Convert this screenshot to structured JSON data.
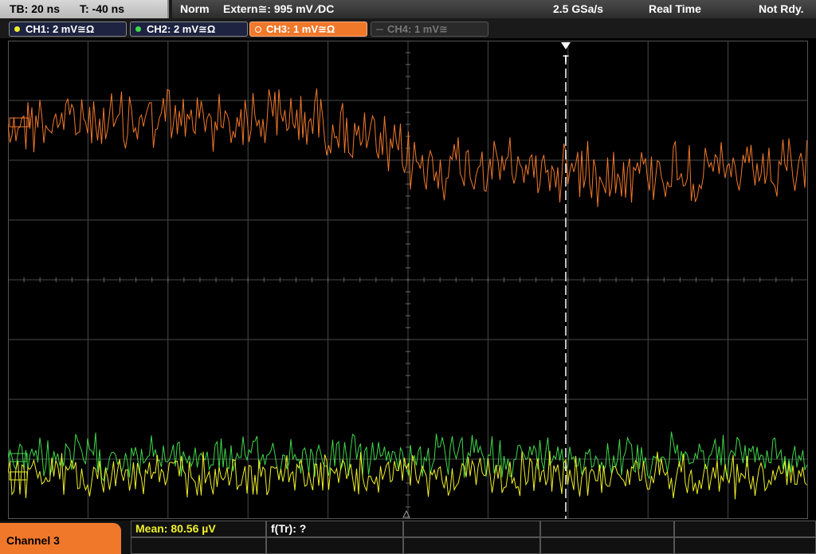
{
  "status_bar": {
    "timebase": "TB: 20 ns",
    "trigger_time": "T: -40 ns",
    "trigger_mode": "Norm",
    "trigger_source": "Extern≅: 995 mV ∕DC",
    "sample_rate": "2.5 GSa/s",
    "acq_mode": "Real Time",
    "state": "Not Rdy."
  },
  "channels": [
    {
      "label": "CH1: 2 mV≅Ω",
      "color": "#f0f02a",
      "active": true
    },
    {
      "label": "CH2: 2 mV≅Ω",
      "color": "#3fd84a",
      "active": true
    },
    {
      "label": "CH3: 1 mV≅Ω",
      "color": "#f0782b",
      "active": true,
      "selected": true
    },
    {
      "label": "CH4: 1 mV≅",
      "color": "#777777",
      "active": false
    }
  ],
  "trigger_marker": "T",
  "bottom": {
    "selected_channel": "Channel 3",
    "mean": "Mean: 80.56 µV",
    "ftr": "f(Tr): ?"
  },
  "colors": {
    "ch1": "#f0f02a",
    "ch2": "#3fd84a",
    "ch3": "#f0782b",
    "grid": "#4a4a4a",
    "grid_dot": "#6a6a6a"
  }
}
